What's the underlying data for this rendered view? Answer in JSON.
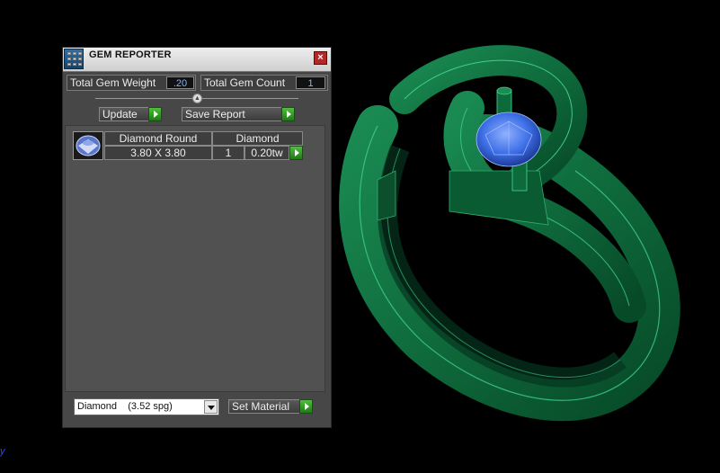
{
  "window": {
    "title": "GEM REPORTER",
    "close_label": "×"
  },
  "summary": {
    "weight_label": "Total Gem Weight",
    "weight_value": ".20",
    "count_label": "Total Gem Count",
    "count_value": "1"
  },
  "toolbar": {
    "update_label": "Update",
    "save_report_label": "Save Report"
  },
  "gem_rows": [
    {
      "shape": "Diamond Round",
      "size": "3.80 X 3.80",
      "material": "Diamond",
      "count": "1",
      "weight": "0.20tw"
    }
  ],
  "material_select": {
    "selected": "Diamond    (3.52 spg)"
  },
  "set_material_label": "Set Material",
  "viewport": {
    "axis_indicator": "y",
    "model": "ring-with-round-gem",
    "model_color": "#0f6b3c",
    "gem_color": "#3d6fe6"
  }
}
